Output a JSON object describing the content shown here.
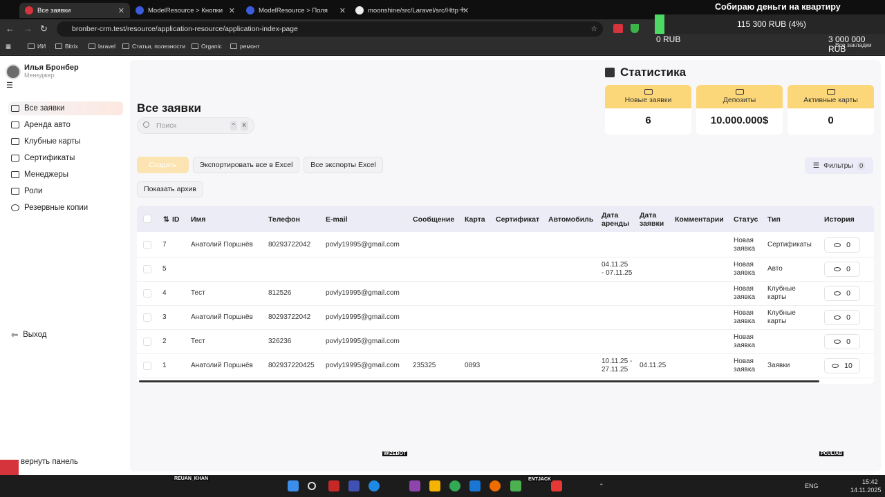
{
  "browser": {
    "tabs": [
      {
        "label": "Все заявки",
        "active": true
      },
      {
        "label": "ModelResource > Кнопки",
        "active": false
      },
      {
        "label": "ModelResource > Поля",
        "active": false
      },
      {
        "label": "moonshine/src/Laravel/src/Http",
        "active": false
      }
    ],
    "url": "bronber-crm.test/resource/application-resource/application-index-page",
    "bookmarks": [
      "ИИ",
      "Bitrix",
      "laravel",
      "Статьи, полезности",
      "Organic",
      "ремонт"
    ],
    "all_bookmarks": "Все закладки"
  },
  "donation": {
    "title": "Собираю деньги на квартиру",
    "collected": "115 300 RUB (4%)",
    "min": "0 RUB",
    "max": "3 000 000 RUB",
    "progress": 0.04
  },
  "user": {
    "name": "Илья Бронбер",
    "role": "Менеджер"
  },
  "sidebar": {
    "items": [
      {
        "label": "Все заявки",
        "active": true
      },
      {
        "label": "Аренда авто"
      },
      {
        "label": "Клубные карты"
      },
      {
        "label": "Сертификаты"
      },
      {
        "label": "Менеджеры"
      },
      {
        "label": "Роли"
      },
      {
        "label": "Резервные копии"
      }
    ],
    "logout": "Выход",
    "collapse": "вернуть панель"
  },
  "page": {
    "title": "Все заявки",
    "search_placeholder": "Поиск",
    "kbd1": "^",
    "kbd2": "K",
    "buttons": {
      "create": "Создать",
      "export_all": "Экспортировать все в Excel",
      "all_exports": "Все экспорты Excel",
      "archive": "Показать архив",
      "filters": "Фильтры",
      "filters_count": "0"
    }
  },
  "stats": {
    "title": "Статистика",
    "cards": [
      {
        "label": "Новые заявки",
        "value": "6"
      },
      {
        "label": "Депозиты",
        "value": "10.000.000$"
      },
      {
        "label": "Активные карты",
        "value": "0"
      }
    ]
  },
  "table": {
    "headers": {
      "id": "ID",
      "name": "Имя",
      "phone": "Телефон",
      "email": "E-mail",
      "message": "Сообщение",
      "card": "Карта",
      "certificate": "Сертификат",
      "car": "Автомобиль",
      "rent_date_1": "Дата",
      "rent_date_2": "аренды",
      "app_date_1": "Дата",
      "app_date_2": "заявки",
      "comments": "Комментарии",
      "status": "Статус",
      "type": "Тип",
      "history": "История"
    },
    "rows": [
      {
        "id": "7",
        "name": "Анатолий Поршнёв",
        "phone": "80293722042",
        "email": "povly19995@gmail.com",
        "message": "",
        "card": "",
        "rent1": "",
        "rent2": "",
        "appdate": "",
        "status1": "Новая",
        "status2": "заявка",
        "type1": "Сертификаты",
        "type2": "",
        "history": "0"
      },
      {
        "id": "5",
        "name": "",
        "phone": "",
        "email": "",
        "message": "",
        "card": "",
        "rent1": "04.11.25",
        "rent2": "- 07.11.25",
        "appdate": "",
        "status1": "Новая",
        "status2": "заявка",
        "type1": "Авто",
        "type2": "",
        "history": "0"
      },
      {
        "id": "4",
        "name": "Тест",
        "phone": "812526",
        "email": "povly19995@gmail.com",
        "message": "",
        "card": "",
        "rent1": "",
        "rent2": "",
        "appdate": "",
        "status1": "Новая",
        "status2": "заявка",
        "type1": "Клубные",
        "type2": "карты",
        "history": "0"
      },
      {
        "id": "3",
        "name": "Анатолий Поршнёв",
        "phone": "80293722042",
        "email": "povly19995@gmail.com",
        "message": "",
        "card": "",
        "rent1": "",
        "rent2": "",
        "appdate": "",
        "status1": "Новая",
        "status2": "заявка",
        "type1": "Клубные",
        "type2": "карты",
        "history": "0"
      },
      {
        "id": "2",
        "name": "Тест",
        "phone": "326236",
        "email": "povly19995@gmail.com",
        "message": "",
        "card": "",
        "rent1": "",
        "rent2": "",
        "appdate": "",
        "status1": "Новая",
        "status2": "заявка",
        "type1": "",
        "type2": "",
        "history": "0"
      },
      {
        "id": "1",
        "name": "Анатолий Поршнёв",
        "phone": "802937220425",
        "email": "povly19995@gmail.com",
        "message": "235325",
        "card": "0893",
        "rent1": "10.11.25 -",
        "rent2": "27.11.25",
        "appdate": "04.11.25",
        "status1": "Новая",
        "status2": "заявка",
        "type1": "Заявки",
        "type2": "",
        "history": "10"
      }
    ]
  },
  "taskbar": {
    "lang": "ENG",
    "time": "15:42",
    "date": "14.11.2025",
    "tag_left": "REUAN_KHAN",
    "tag_mid": "WIZEBOT",
    "tag_right": "PCULIAB",
    "tag_entjack": "ENTJACK"
  },
  "colors": {
    "accent": "#fcd77a",
    "progress": "#4cd964",
    "header_bg": "#ececf6"
  }
}
